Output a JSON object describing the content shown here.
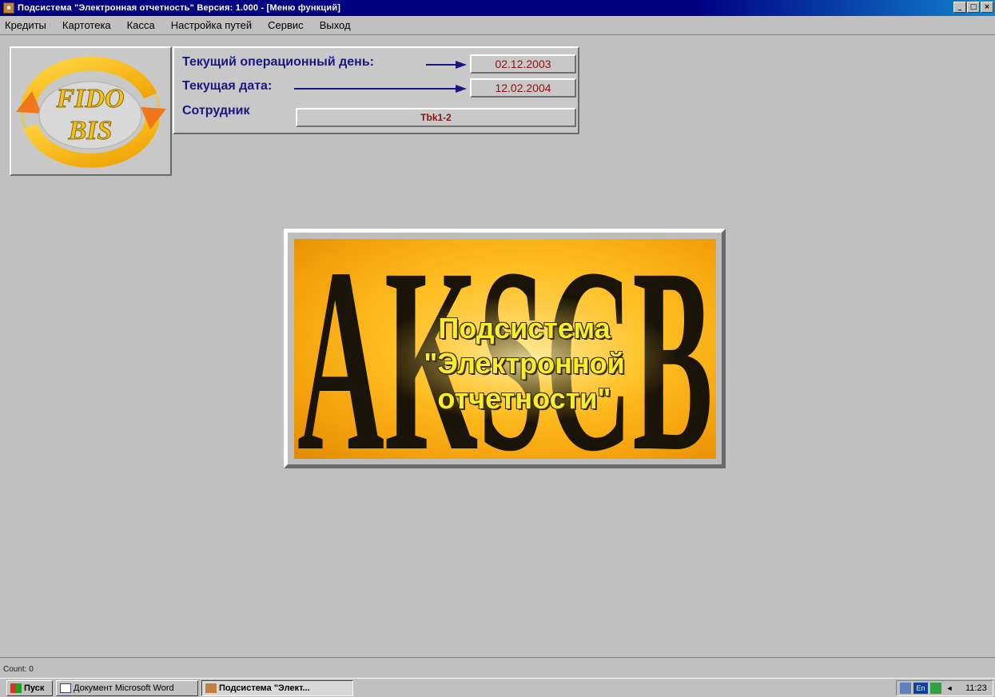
{
  "window": {
    "title": "Подсистема \"Электронная отчетность\"   Версия: 1.000 - [Меню функций]",
    "controls": {
      "minimize": "_",
      "maximize": "□",
      "close": "×"
    }
  },
  "menu": {
    "items": [
      "Кредиты",
      "Картотека",
      "Касса",
      "Настройка путей",
      "Сервис",
      "Выход"
    ]
  },
  "logo": {
    "top_word": "FIDO",
    "bottom_word": "BIS"
  },
  "info": {
    "operational_day_label": "Текущий операционный день:",
    "operational_day_value": "02.12.2003",
    "current_date_label": "Текущая дата:",
    "current_date_value": "12.02.2004",
    "employee_label": "Сотрудник",
    "employee_value": "Tbk1-2"
  },
  "splash": {
    "background_letters": "AKSCB",
    "line1": "Подсистема",
    "line2": "\"Электронной",
    "line3": "отчетности\""
  },
  "status": {
    "text": "Count: 0"
  },
  "taskbar": {
    "start_label": "Пуск",
    "tasks": [
      {
        "label": "Документ Microsoft Word",
        "active": false
      },
      {
        "label": "Подсистема \"Элект...",
        "active": true
      }
    ],
    "tray_lang": "En",
    "clock": "11:23"
  },
  "colors": {
    "titlebar": "#000080",
    "label_text": "#181880",
    "value_text": "#8b1010",
    "splash_text": "#f6ee2a",
    "splash_bg": "#ffbf22"
  }
}
